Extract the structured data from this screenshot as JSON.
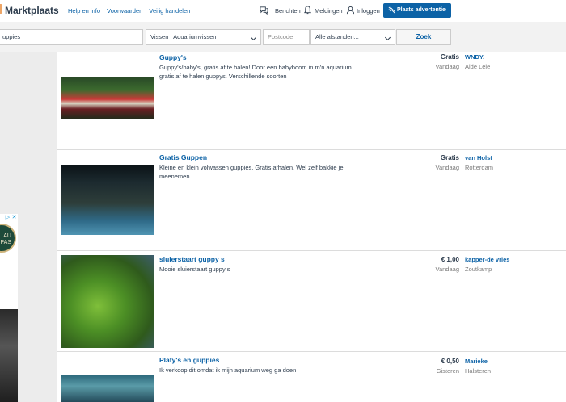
{
  "header": {
    "logo": "Marktplaats",
    "nav_links": [
      "Help en info",
      "Voorwaarden",
      "Veilig handelen"
    ],
    "messages_label": "Berichten",
    "notifications_label": "Meldingen",
    "login_label": "Inloggen",
    "place_ad_label": "Plaats advertentie"
  },
  "search": {
    "query": "uppies",
    "category": "Vissen | Aquariumvissen",
    "postcode_placeholder": "Postcode",
    "distance": "Alle afstanden...",
    "submit_label": "Zoek"
  },
  "ad": {
    "close_icons": [
      "▷",
      "✕"
    ],
    "badge_text": "AU\nPAS"
  },
  "listings": [
    {
      "title": "Guppy's",
      "description": "Guppy's/baby's, gratis af te halen! Door een babyboom in m'n aquarium gratis af te halen guppys. Verschillende soorten",
      "price": "Gratis",
      "date": "Vandaag",
      "seller": "WNDY.",
      "city": "Alde Leie"
    },
    {
      "title": "Gratis Guppen",
      "description": "Kleine en klein volwassen guppies.  Gratis afhalen.  Wel zelf bakkie je meenemen.",
      "price": "Gratis",
      "date": "Vandaag",
      "seller": "van Holst",
      "city": "Rotterdam"
    },
    {
      "title": "sluierstaart guppy s",
      "description": "Mooie sluierstaart guppy s",
      "price": "€ 1,00",
      "date": "Vandaag",
      "seller": "kapper-de vries",
      "city": "Zoutkamp"
    },
    {
      "title": "Platy's en guppies",
      "description": "Ik verkoop dit omdat ik mijn aquarium weg ga doen",
      "price": "€ 0,50",
      "date": "Gisteren",
      "seller": "Marieke",
      "city": "Halsteren"
    }
  ]
}
